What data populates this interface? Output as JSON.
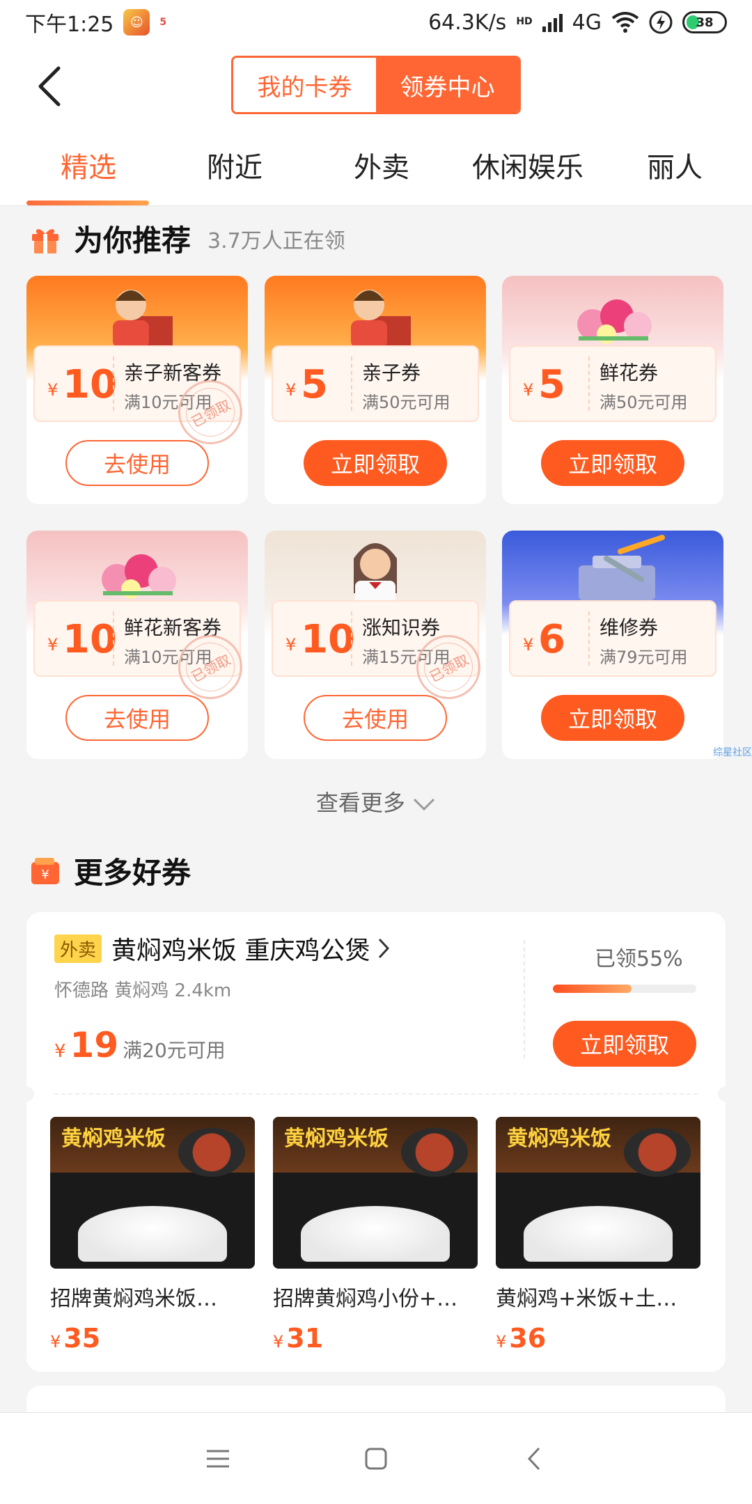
{
  "status": {
    "time": "下午1:25",
    "tiny": "5",
    "speed": "64.3K/s",
    "net_hd": "HD",
    "net": "4G",
    "battery": "38"
  },
  "header": {
    "seg_left": "我的卡券",
    "seg_right": "领券中心"
  },
  "tabs": [
    "精选",
    "附近",
    "外卖",
    "休闲娱乐",
    "丽人"
  ],
  "recommend": {
    "title": "为你推荐",
    "sub": "3.7万人正在领",
    "cards": [
      {
        "yen": "¥",
        "amount": "10",
        "name": "亲子新客券",
        "cond": "满10元可用",
        "button": "去使用",
        "stamp": "已领取"
      },
      {
        "yen": "¥",
        "amount": "5",
        "name": "亲子券",
        "cond": "满50元可用",
        "button": "立即领取"
      },
      {
        "yen": "¥",
        "amount": "5",
        "name": "鲜花券",
        "cond": "满50元可用",
        "button": "立即领取"
      },
      {
        "yen": "¥",
        "amount": "10",
        "name": "鲜花新客券",
        "cond": "满10元可用",
        "button": "去使用",
        "stamp": "已领取"
      },
      {
        "yen": "¥",
        "amount": "10",
        "name": "涨知识券",
        "cond": "满15元可用",
        "button": "去使用",
        "stamp": "已领取"
      },
      {
        "yen": "¥",
        "amount": "6",
        "name": "维修券",
        "cond": "满79元可用",
        "button": "立即领取"
      }
    ],
    "more": "查看更多"
  },
  "watermark": "综星社区",
  "more_coupons": {
    "title": "更多好券",
    "tag": "外卖",
    "shop": "黄焖鸡米饭 重庆鸡公煲",
    "addr": "怀德路 黄焖鸡 2.4km",
    "yen": "¥",
    "amount": "19",
    "cond": "满20元可用",
    "claimed": "已领55%",
    "claimed_fraction": 0.55,
    "button": "立即领取",
    "dishes": [
      {
        "name": "招牌黄焖鸡米饭…",
        "yen": "¥",
        "price": "35",
        "img_text": "黄焖鸡米饭"
      },
      {
        "name": "招牌黄焖鸡小份+…",
        "yen": "¥",
        "price": "31",
        "img_text": "黄焖鸡米饭"
      },
      {
        "name": "黄焖鸡+米饭+土…",
        "yen": "¥",
        "price": "36",
        "img_text": "黄焖鸡米饭"
      }
    ]
  },
  "colors": {
    "accent": "#ff5a1f",
    "accent_light": "#ff6633"
  }
}
